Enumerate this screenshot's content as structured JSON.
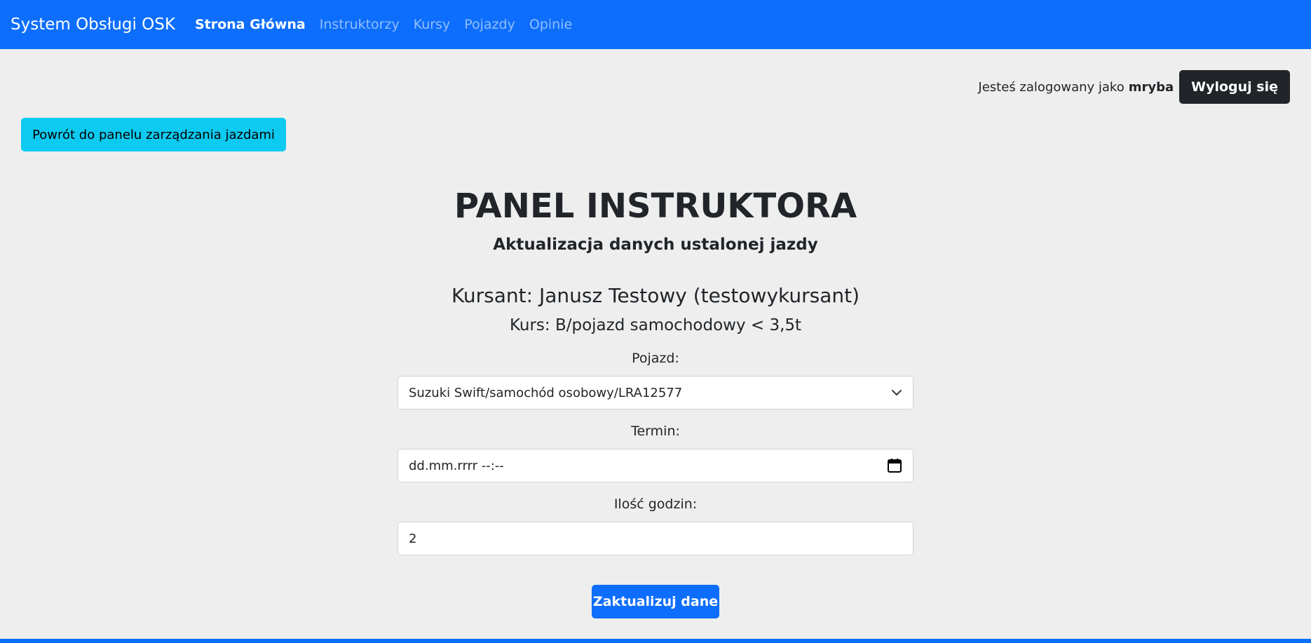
{
  "navbar": {
    "brand": "System Obsługi OSK",
    "links": [
      {
        "label": "Strona Główna",
        "active": true
      },
      {
        "label": "Instruktorzy",
        "active": false
      },
      {
        "label": "Kursy",
        "active": false
      },
      {
        "label": "Pojazdy",
        "active": false
      },
      {
        "label": "Opinie",
        "active": false
      }
    ]
  },
  "user": {
    "logged_in_text": "Jesteś zalogowany jako",
    "username": "mryba",
    "logout_label": "Wyloguj się"
  },
  "back_button_label": "Powrót do panelu zarządzania jazdami",
  "header": {
    "title": "PANEL INSTRUKTORA",
    "subtitle": "Aktualizacja danych ustalonej jazdy"
  },
  "ride": {
    "student": "Kursant: Janusz Testowy (testowykursant)",
    "course": "Kurs: B/pojazd samochodowy < 3,5t"
  },
  "form": {
    "vehicle_label": "Pojazd:",
    "vehicle_value": "Suzuki Swift/samochód osobowy/LRA12577",
    "date_label": "Termin:",
    "date_placeholder": "dd.mm.rrrr --:--",
    "hours_label": "Ilość godzin:",
    "hours_value": "2",
    "submit_label": "Zaktualizuj dane"
  },
  "colors": {
    "primary": "#0d6efd",
    "info": "#0dcaf0",
    "dark": "#212529",
    "background": "#eeeeee"
  },
  "icons": {
    "vehicle_select": "chevron-down-icon",
    "date_picker": "calendar-icon"
  }
}
